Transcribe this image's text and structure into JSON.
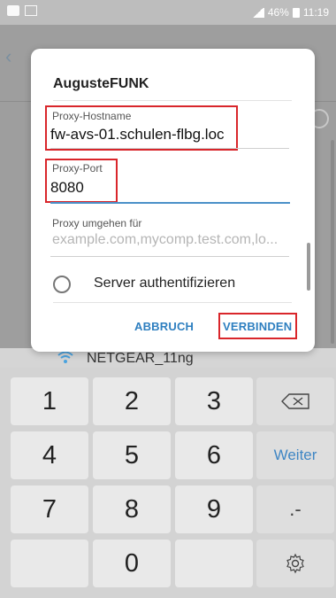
{
  "status_bar": {
    "battery": "46%",
    "time": "11:19",
    "icons": [
      "message-icon",
      "image-icon",
      "signal-icon",
      "battery-icon"
    ]
  },
  "background": {
    "wifi_network_name": "NETGEAR_11ng"
  },
  "dialog": {
    "title": "AugusteFUNK",
    "proxy_hostname": {
      "label": "Proxy-Hostname",
      "value": "fw-avs-01.schulen-flbg.loc"
    },
    "proxy_port": {
      "label": "Proxy-Port",
      "value": "8080"
    },
    "bypass": {
      "label": "Proxy umgehen für",
      "placeholder": "example.com,mycomp.test.com,lo..."
    },
    "server_auth_label": "Server authentifizieren",
    "cancel_label": "ABBRUCH",
    "connect_label": "VERBINDEN"
  },
  "keyboard": {
    "row1": [
      "1",
      "2",
      "3",
      "⌫"
    ],
    "row2": [
      "4",
      "5",
      "6",
      "Weiter"
    ],
    "row3": [
      "7",
      "8",
      "9",
      ".-"
    ],
    "row4": [
      "",
      "0",
      "",
      "⚙"
    ]
  },
  "colors": {
    "accent": "#2e7fc0",
    "highlight": "#d9262b",
    "focus_line": "#4a90c8"
  }
}
